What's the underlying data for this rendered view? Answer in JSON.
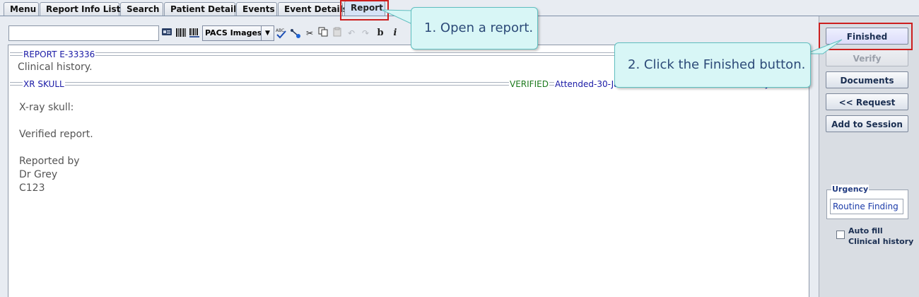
{
  "tabs": [
    {
      "label": "Menu"
    },
    {
      "label": "Report Info Lists"
    },
    {
      "label": "Search"
    },
    {
      "label": "Patient Details"
    },
    {
      "label": "Events"
    },
    {
      "label": "Event Details"
    },
    {
      "label": "Report",
      "active": true
    }
  ],
  "toolbar": {
    "search_value": "",
    "pacs_label": "PACS Images",
    "icons": [
      "id-card-icon",
      "barcode-icon",
      "barcode-print-icon",
      "spellcheck-icon",
      "link-icon",
      "cut-icon",
      "copy-icon",
      "paste-icon",
      "undo-icon",
      "redo-icon",
      "bold-icon",
      "italic-icon"
    ]
  },
  "report": {
    "section1_label": "REPORT E-33336",
    "clinical_history": "Clinical history.",
    "section2_label": "XR SKULL",
    "status": "VERIFIED",
    "attended": "Attended-30-Jan-2025 - EXTERNAL EXTERNAL 30-Jan-2025",
    "body_lines": [
      "X-ray skull:",
      "",
      "Verified report.",
      "",
      "Reported by",
      "Dr Grey",
      "C123"
    ]
  },
  "panel": {
    "finished": "Finished",
    "verify": "Verify",
    "documents": "Documents",
    "request": "<< Request",
    "add_to_session": "Add to Session",
    "urgency_label": "Urgency",
    "urgency_value": "Routine Finding",
    "autofill_line1": "Auto fill",
    "autofill_line2": "Clinical history"
  },
  "callouts": {
    "step1": "1. Open a report.",
    "step2": "2. Click the Finished button."
  },
  "colors": {
    "highlight": "#cc1f1f",
    "callout_bg": "#d8f6f6",
    "status_green": "#1d7a1d",
    "label_blue": "#1a1aa6"
  }
}
